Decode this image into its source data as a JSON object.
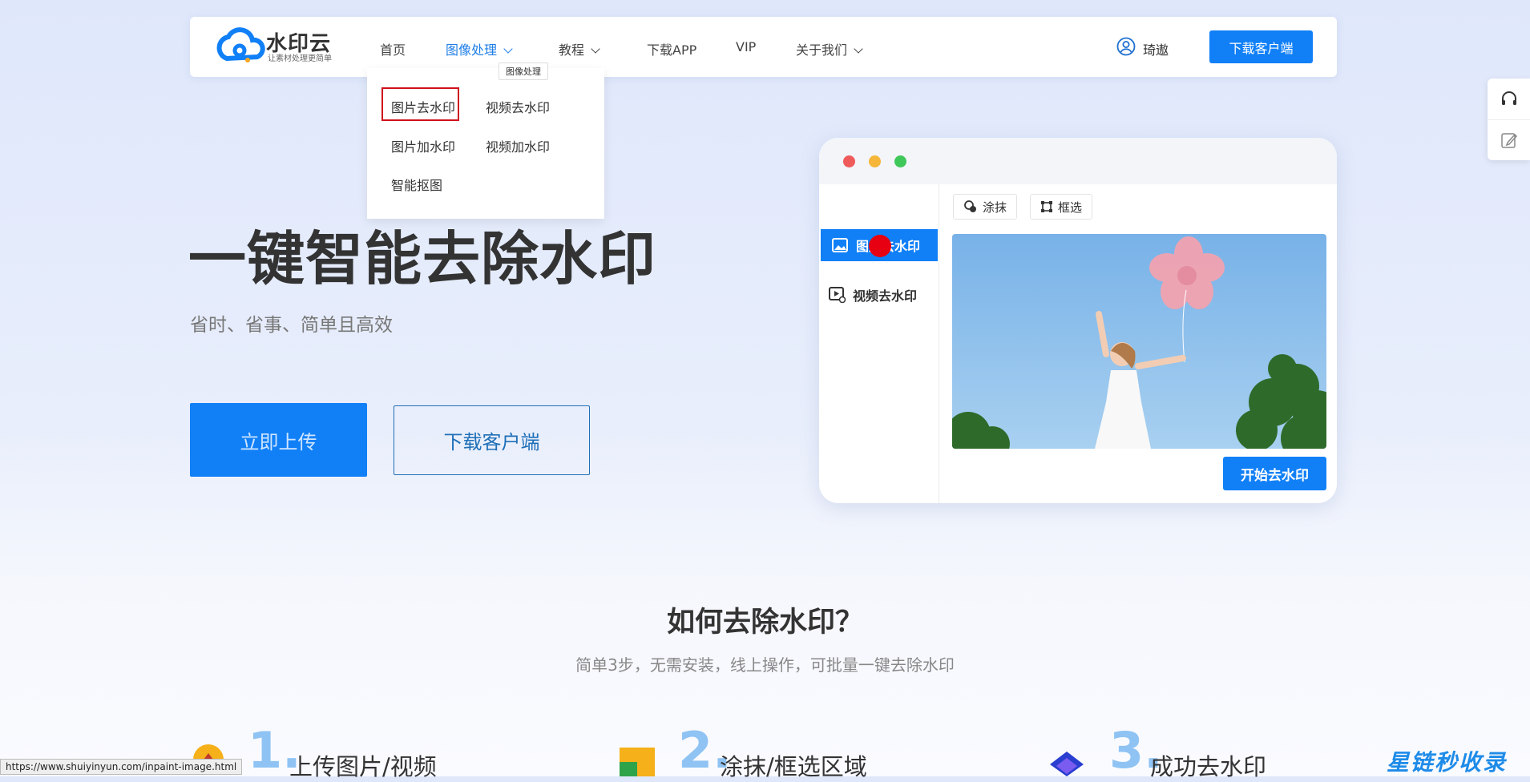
{
  "brand": {
    "name": "水印云",
    "tagline": "让素材处理更简单"
  },
  "nav": {
    "items": [
      {
        "label": "首页"
      },
      {
        "label": "图像处理",
        "active": true,
        "dropdown": true
      },
      {
        "label": "教程",
        "dropdown": true
      },
      {
        "label": "下载APP"
      },
      {
        "label": "VIP"
      },
      {
        "label": "关于我们",
        "dropdown": true
      }
    ],
    "user_name": "琦遨",
    "download_label": "下载客户端"
  },
  "dropdown": {
    "tooltip": "图像处理",
    "items": [
      "图片去水印",
      "视频去水印",
      "图片加水印",
      "视频加水印",
      "智能抠图"
    ],
    "highlighted": "图片去水印"
  },
  "hero": {
    "title": "一键智能去除水印",
    "subtitle": "省时、省事、简单且高效",
    "upload_label": "立即上传",
    "download_label": "下载客户端"
  },
  "preview": {
    "side_active": "图片去水印",
    "side_video": "视频去水印",
    "tool_smear": "涂抹",
    "tool_box": "框选",
    "start_label": "开始去水印"
  },
  "how": {
    "title": "如何去除水印？",
    "subtitle": "简单3步，无需安装，线上操作，可批量一键去除水印",
    "steps": [
      {
        "num": "1.",
        "label": "上传图片/视频"
      },
      {
        "num": "2.",
        "label": "涂抹/框选区域"
      },
      {
        "num": "3.",
        "label": "成功去水印"
      }
    ]
  },
  "status_url": "https://www.shuiyinyun.com/inpaint-image.html",
  "watermark": "星链秒收录",
  "colors": {
    "accent": "#1180f7",
    "highlight_border": "#d0101c",
    "red_dot": "#e60012"
  }
}
